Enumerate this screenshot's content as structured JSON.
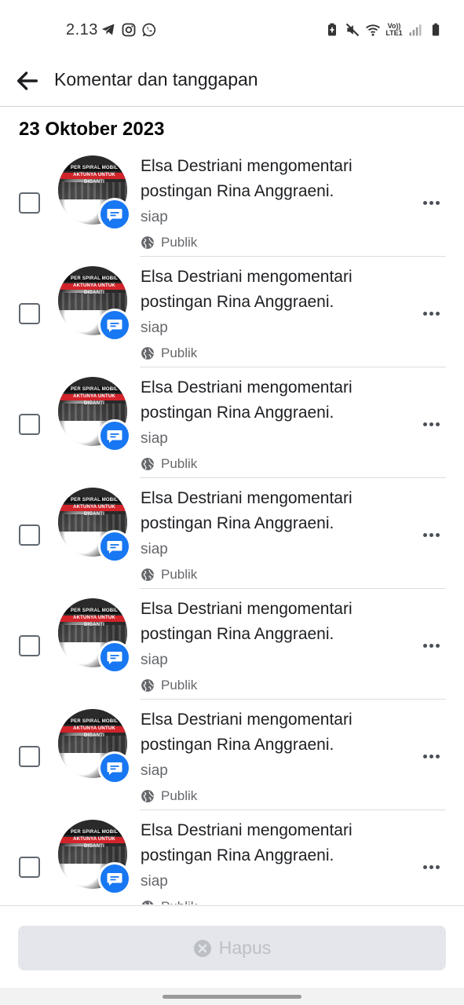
{
  "status_bar": {
    "time": "2.13",
    "left_icons": [
      "telegram-icon",
      "instagram-icon",
      "whatsapp-icon"
    ],
    "volte_line1": "Vo))",
    "volte_line2": "LTE1",
    "right_icons": [
      "battery-saver-icon",
      "mute-icon",
      "wifi-icon",
      "volte-icon",
      "signal-icon",
      "battery-icon"
    ]
  },
  "app_bar": {
    "title": "Komentar dan tanggapan"
  },
  "section": {
    "date": "23 Oktober 2023"
  },
  "avatar_text": "PER SPIRAL MOBIL AKTUNYA UNTUK DIGANTI",
  "items": [
    {
      "title": "Elsa Destriani mengomentari postingan Rina Anggraeni.",
      "comment": "siap",
      "privacy": "Publik"
    },
    {
      "title": "Elsa Destriani mengomentari postingan Rina Anggraeni.",
      "comment": "siap",
      "privacy": "Publik"
    },
    {
      "title": "Elsa Destriani mengomentari postingan Rina Anggraeni.",
      "comment": "siap",
      "privacy": "Publik"
    },
    {
      "title": "Elsa Destriani mengomentari postingan Rina Anggraeni.",
      "comment": "siap",
      "privacy": "Publik"
    },
    {
      "title": "Elsa Destriani mengomentari postingan Rina Anggraeni.",
      "comment": "siap",
      "privacy": "Publik"
    },
    {
      "title": "Elsa Destriani mengomentari postingan Rina Anggraeni.",
      "comment": "siap",
      "privacy": "Publik"
    },
    {
      "title": "Elsa Destriani mengomentari postingan Rina Anggraeni.",
      "comment": "siap",
      "privacy": "Publik"
    }
  ],
  "footer": {
    "delete_label": "Hapus"
  },
  "colors": {
    "accent": "#1877f2",
    "disabled_button_bg": "#e4e6eb",
    "disabled_text": "#bcc0c4",
    "secondary_text": "#65676b"
  }
}
